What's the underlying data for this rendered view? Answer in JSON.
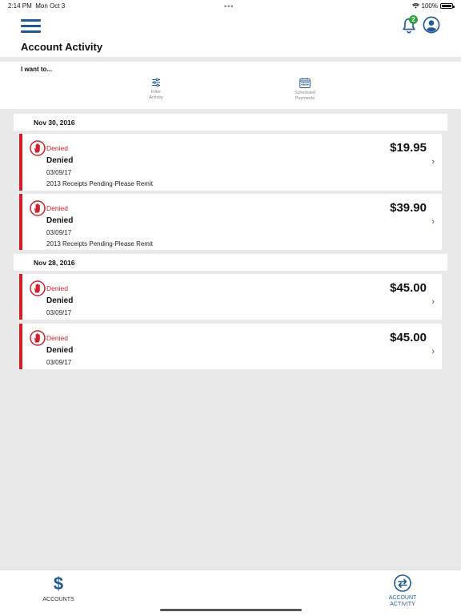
{
  "status_bar": {
    "time": "2:14 PM",
    "date": "Mon Oct 3",
    "battery": "100%"
  },
  "header": {
    "title": "Account Activity",
    "notification_count": "2"
  },
  "i_want_to": {
    "label": "I want to...",
    "actions": [
      {
        "line1": "Filter",
        "line2": "Activity"
      },
      {
        "line1": "Scheduled",
        "line2": "Payments"
      }
    ]
  },
  "groups": [
    {
      "date": "Nov 30, 2016",
      "items": [
        {
          "status": "Denied",
          "title": "Denied",
          "date": "03/09/17",
          "description": "2013 Receipts Pending-Please Remit",
          "amount": "$19.95"
        },
        {
          "status": "Denied",
          "title": "Denied",
          "date": "03/09/17",
          "description": "2013 Receipts Pending-Please Remit",
          "amount": "$39.90"
        }
      ]
    },
    {
      "date": "Nov 28, 2016",
      "items": [
        {
          "status": "Denied",
          "title": "Denied",
          "date": "03/09/17",
          "amount": "$45.00"
        },
        {
          "status": "Denied",
          "title": "Denied",
          "date": "03/09/17",
          "amount": "$45.00"
        }
      ]
    }
  ],
  "tabbar": {
    "accounts": "ACCOUNTS",
    "activity_line1": "ACCOUNT",
    "activity_line2": "ACTIVITY"
  },
  "colors": {
    "accent": "#1e5a96",
    "denied": "#d0202a",
    "badge": "#2ea043"
  },
  "icons": {
    "menu": "hamburger-icon",
    "bell": "bell-icon",
    "profile": "user-icon",
    "filter": "sliders-icon",
    "calendar": "calendar-icon",
    "denied": "stop-hand-icon",
    "chevron": "chevron-right-icon",
    "accounts": "dollar-icon",
    "activity": "transfer-icon"
  }
}
